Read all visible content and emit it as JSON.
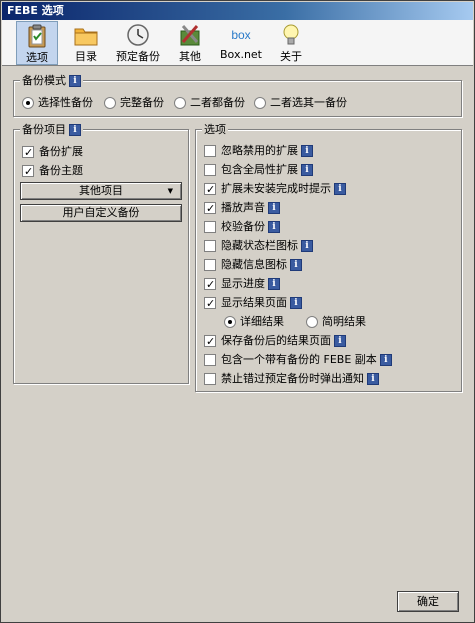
{
  "window": {
    "title": "FEBE 选项"
  },
  "toolbar": {
    "items": [
      {
        "label": "选项",
        "icon": "clipboard-icon"
      },
      {
        "label": "目录",
        "icon": "folder-icon"
      },
      {
        "label": "预定备份",
        "icon": "clock-icon"
      },
      {
        "label": "其他",
        "icon": "tools-icon"
      },
      {
        "label": "Box.net",
        "icon": "box-logo-icon"
      },
      {
        "label": "关于",
        "icon": "lightbulb-icon"
      }
    ]
  },
  "backup_mode": {
    "title": "备份模式",
    "options": [
      {
        "label": "选择性备份",
        "selected": true
      },
      {
        "label": "完整备份",
        "selected": false
      },
      {
        "label": "二者都备份",
        "selected": false
      },
      {
        "label": "二者选其一备份",
        "selected": false
      }
    ]
  },
  "backup_items": {
    "title": "备份项目",
    "items": [
      {
        "label": "备份扩展",
        "checked": true
      },
      {
        "label": "备份主题",
        "checked": true
      }
    ],
    "other_items_label": "其他项目",
    "custom_backup_label": "用户自定义备份"
  },
  "options": {
    "title": "选项",
    "items": [
      {
        "label": "忽略禁用的扩展",
        "checked": false
      },
      {
        "label": "包含全局性扩展",
        "checked": false
      },
      {
        "label": "扩展未安装完成时提示",
        "checked": true
      },
      {
        "label": "播放声音",
        "checked": true
      },
      {
        "label": "校验备份",
        "checked": false
      },
      {
        "label": "隐藏状态栏图标",
        "checked": false
      },
      {
        "label": "隐藏信息图标",
        "checked": false
      },
      {
        "label": "显示进度",
        "checked": true
      },
      {
        "label": "显示结果页面",
        "checked": true
      },
      {
        "label": "保存备份后的结果页面",
        "checked": true
      },
      {
        "label": "包含一个带有备份的 FEBE 副本",
        "checked": false
      },
      {
        "label": "禁止错过预定备份时弹出通知",
        "checked": false
      }
    ],
    "result_detail": {
      "detailed": "详细结果",
      "brief": "简明结果",
      "selected": "detailed"
    }
  },
  "footer": {
    "ok_label": "确定"
  },
  "colors": {
    "titlebar": "#0a246a",
    "info_icon": "#3a5ba0",
    "toolbar_active": "#c3d5ee"
  }
}
